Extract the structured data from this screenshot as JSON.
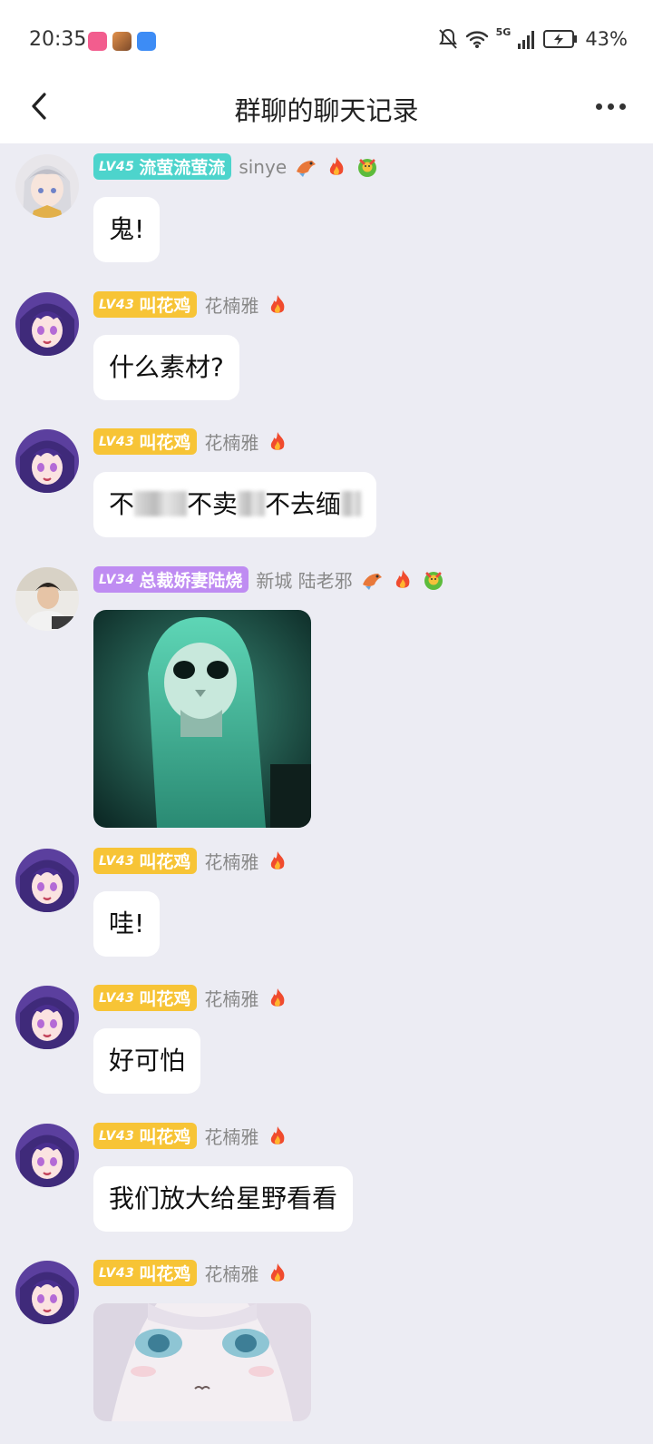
{
  "status": {
    "time": "20:35",
    "battery": "43%",
    "network": "5G"
  },
  "nav": {
    "title": "群聊的聊天记录"
  },
  "messages": [
    {
      "level": "LV45",
      "title": "流萤流萤流",
      "name": "sinye",
      "text": "鬼!"
    },
    {
      "level": "LV43",
      "title": "叫花鸡",
      "name": "花楠雅",
      "text": "什么素材?"
    },
    {
      "level": "LV43",
      "title": "叫花鸡",
      "name": "花楠雅",
      "text_parts": [
        "不",
        "不卖",
        "不去缅"
      ]
    },
    {
      "level": "LV34",
      "title": "总裁娇妻陆烧",
      "name": "新城 陆老邪"
    },
    {
      "level": "LV43",
      "title": "叫花鸡",
      "name": "花楠雅",
      "text": "哇!"
    },
    {
      "level": "LV43",
      "title": "叫花鸡",
      "name": "花楠雅",
      "text": "好可怕"
    },
    {
      "level": "LV43",
      "title": "叫花鸡",
      "name": "花楠雅",
      "text": "我们放大给星野看看"
    },
    {
      "level": "LV43",
      "title": "叫花鸡",
      "name": "花楠雅"
    }
  ],
  "colors": {
    "lv_teal": "#4dd4cc",
    "lv_yellow": "#f7c436",
    "lv_purple": "#bf8cf2",
    "background": "#ececf3"
  },
  "icons": [
    "back-arrow-icon",
    "more-icon",
    "fire-icon",
    "dragon-icon",
    "flower-icon",
    "wifi-icon",
    "signal-icon",
    "battery-icon",
    "mute-icon"
  ]
}
